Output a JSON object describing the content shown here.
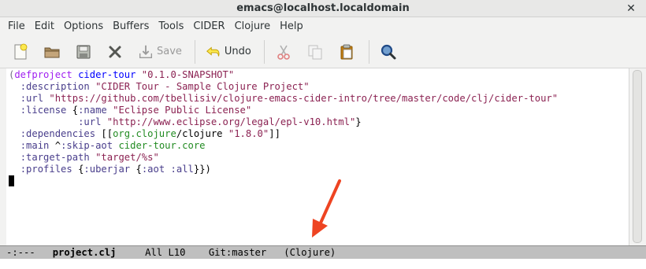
{
  "window": {
    "title": "emacs@localhost.localdomain",
    "close_glyph": "✕"
  },
  "menubar": {
    "items": [
      "File",
      "Edit",
      "Options",
      "Buffers",
      "Tools",
      "CIDER",
      "Clojure",
      "Help"
    ]
  },
  "toolbar": {
    "save_label": "Save",
    "undo_label": "Undo",
    "icons": [
      "new-file-icon",
      "open-folder-icon",
      "save-disk-icon",
      "close-x-icon",
      "save-icon",
      "undo-icon",
      "cut-icon",
      "copy-icon",
      "paste-icon",
      "search-icon"
    ]
  },
  "editor": {
    "lines": [
      [
        [
          "paren",
          "("
        ],
        [
          "keyword",
          "defproject"
        ],
        [
          "plain",
          " "
        ],
        [
          "def",
          "cider-tour"
        ],
        [
          "plain",
          " "
        ],
        [
          "string",
          "\"0.1.0-SNAPSHOT\""
        ]
      ],
      [
        [
          "plain",
          "  "
        ],
        [
          "kw",
          ":description"
        ],
        [
          "plain",
          " "
        ],
        [
          "string",
          "\"CIDER Tour - Sample Clojure Project\""
        ]
      ],
      [
        [
          "plain",
          "  "
        ],
        [
          "kw",
          ":url"
        ],
        [
          "plain",
          " "
        ],
        [
          "string",
          "\"https://github.com/tbellisiv/clojure-emacs-cider-intro/tree/master/code/clj/cider-tour\""
        ]
      ],
      [
        [
          "plain",
          "  "
        ],
        [
          "kw",
          ":license"
        ],
        [
          "plain",
          " {"
        ],
        [
          "kw",
          ":name"
        ],
        [
          "plain",
          " "
        ],
        [
          "string",
          "\"Eclipse Public License\""
        ]
      ],
      [
        [
          "plain",
          "            "
        ],
        [
          "kw",
          ":url"
        ],
        [
          "plain",
          " "
        ],
        [
          "string",
          "\"http://www.eclipse.org/legal/epl-v10.html\""
        ],
        [
          "plain",
          "}"
        ]
      ],
      [
        [
          "plain",
          "  "
        ],
        [
          "kw",
          ":dependencies"
        ],
        [
          "plain",
          " [["
        ],
        [
          "sym",
          "org.clojure"
        ],
        [
          "plain",
          "/clojure "
        ],
        [
          "string",
          "\"1.8.0\""
        ],
        [
          "plain",
          "]]"
        ]
      ],
      [
        [
          "plain",
          "  "
        ],
        [
          "kw",
          ":main"
        ],
        [
          "plain",
          " ^"
        ],
        [
          "kw",
          ":skip-aot"
        ],
        [
          "plain",
          " "
        ],
        [
          "sym",
          "cider-tour.core"
        ]
      ],
      [
        [
          "plain",
          "  "
        ],
        [
          "kw",
          ":target-path"
        ],
        [
          "plain",
          " "
        ],
        [
          "string",
          "\"target/%s\""
        ]
      ],
      [
        [
          "plain",
          "  "
        ],
        [
          "kw",
          ":profiles"
        ],
        [
          "plain",
          " {"
        ],
        [
          "kw",
          ":uberjar"
        ],
        [
          "plain",
          " {"
        ],
        [
          "kw",
          ":aot"
        ],
        [
          "plain",
          " "
        ],
        [
          "kw",
          ":all"
        ],
        [
          "plain",
          "}})"
        ]
      ]
    ]
  },
  "modeline": {
    "status": "-:---",
    "buffer_name": "project.clj",
    "position": "All L10",
    "vc": "Git:master",
    "major_mode": "(Clojure)"
  },
  "colors": {
    "keyword": "#a020f0",
    "function_name": "#0000ff",
    "string": "#8b2252",
    "constant": "#483d8b",
    "symbol": "#228b22",
    "annotation_arrow": "#ee4422"
  }
}
